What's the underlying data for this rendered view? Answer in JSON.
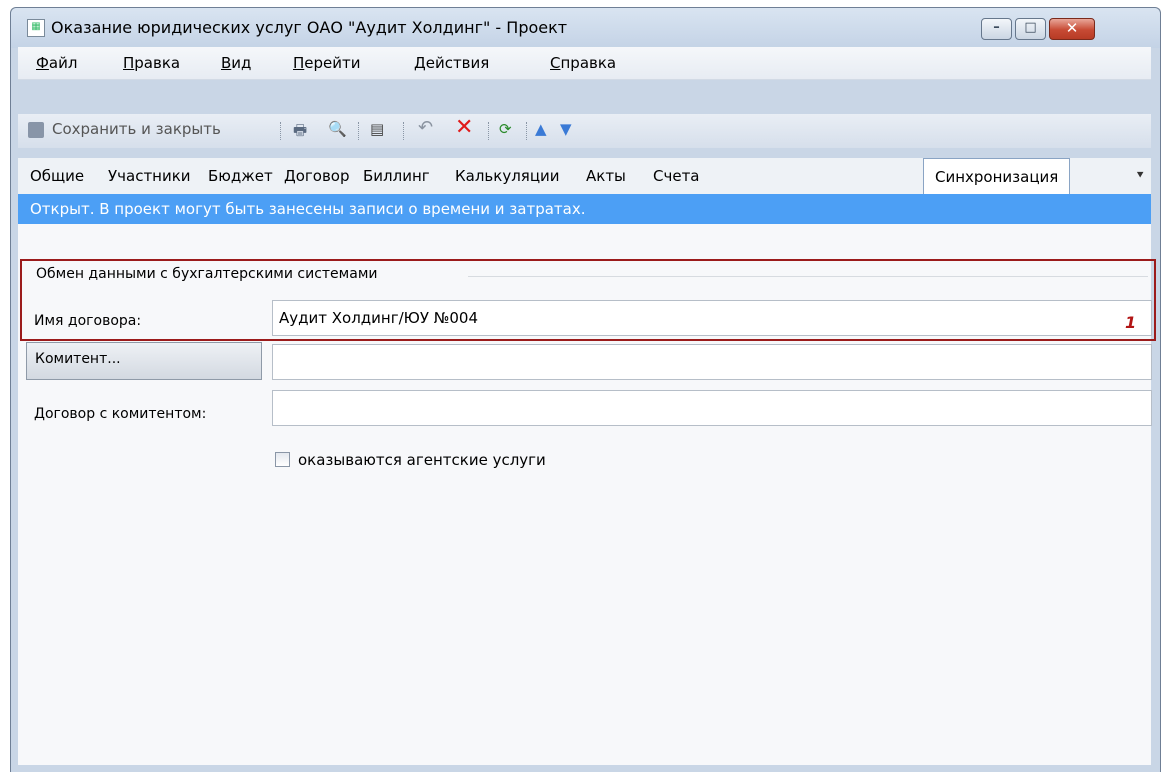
{
  "window": {
    "title": "Оказание юридических услуг ОАО \"Аудит Холдинг\" - Проект",
    "minimize_glyph": "–",
    "maximize_glyph": "□",
    "close_glyph": "✕"
  },
  "menu": {
    "items": [
      {
        "label_u": "Ф",
        "label_rest": "айл"
      },
      {
        "label_u": "П",
        "label_rest": "равка"
      },
      {
        "label_u": "В",
        "label_rest": "ид"
      },
      {
        "label_u": "П",
        "label_rest": "ерейти"
      },
      {
        "label_u": "Д",
        "label_rest": "ействия"
      },
      {
        "label_u": "С",
        "label_rest": "правка"
      }
    ]
  },
  "toolbar": {
    "save_close_label": "Сохранить и закрыть",
    "icons": [
      "save-icon",
      "print-icon",
      "print-preview-icon",
      "properties-icon",
      "undo-icon",
      "delete-icon",
      "refresh-icon",
      "up-arrow-icon",
      "down-arrow-icon"
    ]
  },
  "tabs": {
    "items": [
      "Общие",
      "Участники",
      "Бюджет",
      "Договор",
      "Биллинг",
      "Калькуляции",
      "Акты",
      "Счета",
      "Синхронизация"
    ],
    "active": "Синхронизация"
  },
  "infobar": {
    "text": "Открыт. В проект могут быть занесены записи о времени и затратах.",
    "color": "#4c9ff5"
  },
  "form": {
    "group_title": "Обмен данными с бухгалтерскими системами",
    "contract_name_label": "Имя договора:",
    "contract_name_value": "Аудит Холдинг/ЮУ №004",
    "annotation_number": "1",
    "committent_button": "Комитент...",
    "committent_value": "",
    "committent_contract_label": "Договор с комитентом:",
    "committent_contract_value": "",
    "agent_services_label": "оказываются агентские услуги",
    "agent_services_checked": false
  }
}
